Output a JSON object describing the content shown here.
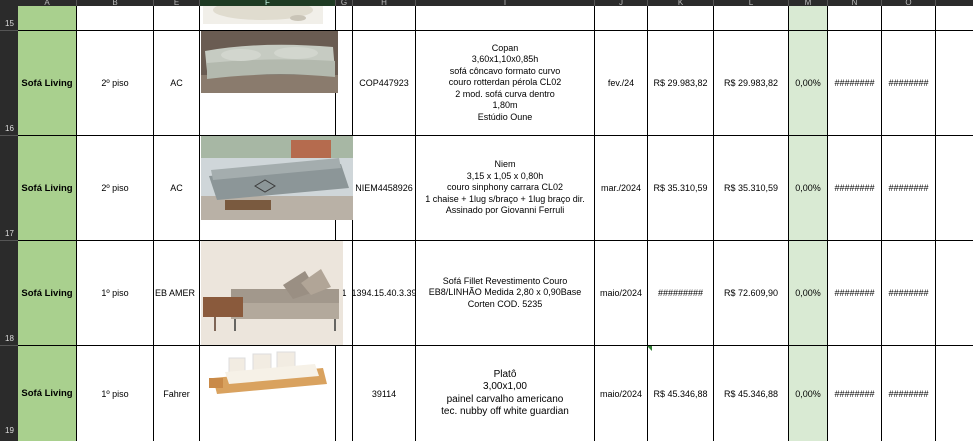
{
  "columns": [
    "A",
    "B",
    "E",
    "F",
    "G",
    "H",
    "I",
    "J",
    "K",
    "L",
    "M",
    "N",
    "O"
  ],
  "rows": [
    {
      "num": "15",
      "cells": {
        "A": "",
        "B": "",
        "E": "",
        "G": "",
        "H": "",
        "I": [],
        "J": "",
        "K": "",
        "L": "",
        "M": "",
        "N": "",
        "O": ""
      }
    },
    {
      "num": "16",
      "cells": {
        "A": "Sofá Living",
        "B": "2º piso",
        "E": "AC",
        "G": "",
        "H": "COP447923",
        "I": [
          "Copan",
          "3,60x1,10x0,85h",
          "sofá côncavo formato curvo",
          "couro rotterdan pérola CL02",
          "2 mod. sofá curva dentro",
          "1,80m",
          "Estúdio Oune"
        ],
        "J": "fev./24",
        "K": "R$ 29.983,82",
        "L": "R$ 29.983,82",
        "M": "0,00%",
        "N": "########",
        "O": "########"
      }
    },
    {
      "num": "17",
      "cells": {
        "A": "Sofá Living",
        "B": "2º piso",
        "E": "AC",
        "G": "",
        "H": "NIEM4458926",
        "I": [
          "Niem",
          "3,15 x 1,05 x 0,80h",
          "couro sinphony carrara CL02",
          "1 chaise + 1lug s/braço + 1lug braço dir.",
          "Assinado por Giovanni Ferruli"
        ],
        "J": "mar./2024",
        "K": "R$ 35.310,59",
        "L": "R$ 35.310,59",
        "M": "0,00%",
        "N": "########",
        "O": "########"
      }
    },
    {
      "num": "18",
      "cells": {
        "A": "Sofá Living",
        "B": "1º piso",
        "E": "EB AMER",
        "G": "1",
        "H": "1394.15.40.3.39",
        "I": [
          "Sofá Fillet Revestimento Couro",
          "EB8/LINHÃO Medida 2,80 x 0,90Base",
          "Corten COD. 5235"
        ],
        "J": "maio/2024",
        "K": "#########",
        "L": "R$ 72.609,90",
        "M": "0,00%",
        "N": "########",
        "O": "########"
      }
    },
    {
      "num": "19",
      "cells": {
        "A": "Sofá Living",
        "B": "1º piso",
        "E": "Fahrer",
        "G": "",
        "H": "39114",
        "I": [
          "Platô",
          "3,00x1,00",
          "painel carvalho americano",
          "tec. nubby off white guardian"
        ],
        "J": "maio/2024",
        "K": "R$ 45.346,88",
        "L": "R$ 45.346,88",
        "M": "0,00%",
        "N": "########",
        "O": "########"
      }
    }
  ],
  "colors": {
    "green": "#a9d08e",
    "light_green": "#d9ead3",
    "header": "#2b2b2b"
  }
}
